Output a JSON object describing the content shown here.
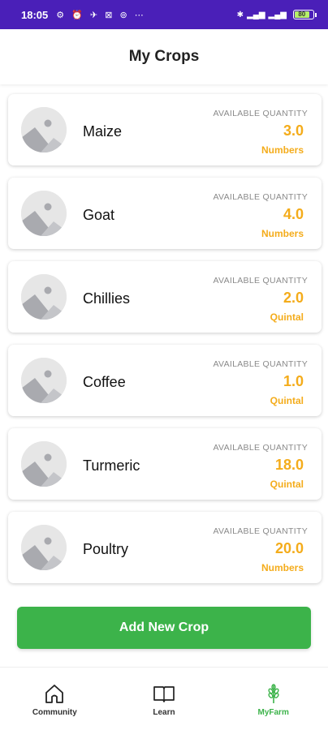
{
  "status_bar": {
    "time": "18:05",
    "battery": "80"
  },
  "header": {
    "title": "My Crops"
  },
  "crops": [
    {
      "name": "Maize",
      "quantity_label": "AVAILABLE QUANTITY",
      "quantity": "3.0",
      "unit": "Numbers"
    },
    {
      "name": "Goat",
      "quantity_label": "AVAILABLE QUANTITY",
      "quantity": "4.0",
      "unit": "Numbers"
    },
    {
      "name": "Chillies",
      "quantity_label": "AVAILABLE QUANTITY",
      "quantity": "2.0",
      "unit": "Quintal"
    },
    {
      "name": "Coffee",
      "quantity_label": "AVAILABLE QUANTITY",
      "quantity": "1.0",
      "unit": "Quintal"
    },
    {
      "name": "Turmeric",
      "quantity_label": "AVAILABLE QUANTITY",
      "quantity": "18.0",
      "unit": "Quintal"
    },
    {
      "name": "Poultry",
      "quantity_label": "AVAILABLE QUANTITY",
      "quantity": "20.0",
      "unit": "Numbers"
    }
  ],
  "add_button": {
    "label": "Add New Crop"
  },
  "bottom_nav": {
    "items": [
      {
        "label": "Community",
        "icon": "home-icon",
        "active": false
      },
      {
        "label": "Learn",
        "icon": "book-icon",
        "active": false
      },
      {
        "label": "MyFarm",
        "icon": "wheat-icon",
        "active": true
      }
    ]
  },
  "colors": {
    "status_bar": "#4a1fb8",
    "accent_green": "#3cb34a",
    "quantity_orange": "#f4ac1b"
  }
}
